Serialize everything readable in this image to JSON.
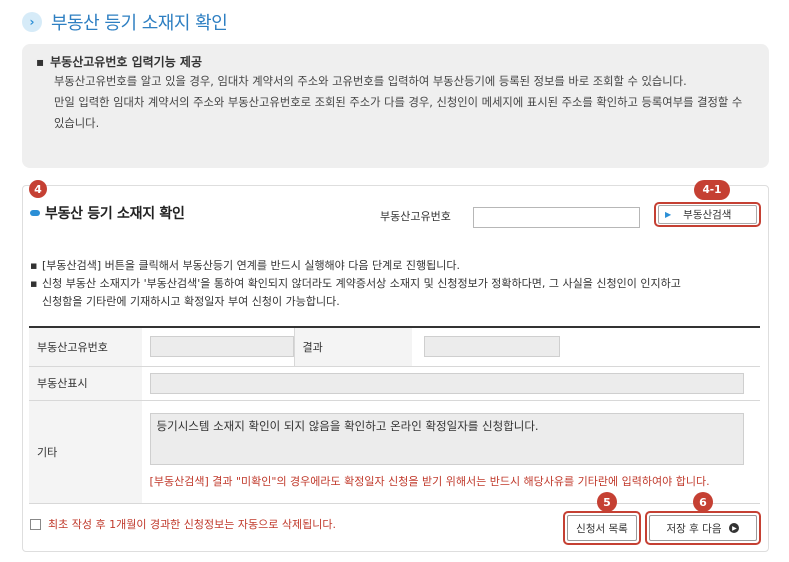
{
  "page_title": "부동산 등기 소재지 확인",
  "info": {
    "heading": "부동산고유번호 입력기능 제공",
    "bullet": "▪",
    "para1": "부동산고유번호를 알고 있을 경우, 임대차 계약서의 주소와 고유번호를 입력하여 부동산등기에 등록된 정보를 바로 조회할 수 있습니다.",
    "para2": "만일 입력한 임대차 계약서의 주소와 부동산고유번호로 조회된 주소가 다를 경우, 신청인이 메세지에 표시된 주소를 확인하고 등록여부를 결정할 수 있습니다."
  },
  "section": {
    "badge": "4",
    "title": "부동산 등기 소재지 확인",
    "uid_label": "부동산고유번호",
    "uid_value": "",
    "search_badge": "4-1",
    "search_button": "부동산검색"
  },
  "notes": {
    "bullet": "▪",
    "note1": "[부동산검색] 버튼을 클릭해서 부동산등기 연계를 반드시 실행해야 다음 단계로 진행됩니다.",
    "note2_line1": "신청 부동산 소재지가 '부동산검색'을 통하여 확인되지 않더라도 계약증서상 소재지 및 신청정보가 정확하다면, 그 사실을 신청인이 인지하고",
    "note2_line2": "신청함을 기타란에 기재하시고 확정일자 부여 신청이 가능합니다."
  },
  "table": {
    "uid_label": "부동산고유번호",
    "uid_value": "",
    "result_label": "결과",
    "result_value": "",
    "display_label": "부동산표시",
    "display_value": "",
    "etc_label": "기타",
    "etc_value": "등기시스템 소재지 확인이 되지 않음을 확인하고 온라인 확정일자를 신청합니다.",
    "etc_note": "[부동산검색] 결과 \"미확인\"의 경우에라도 확정일자 신청을 받기 위해서는 반드시 해당사유를 기타란에 입력하여야 합니다."
  },
  "footer": {
    "auto_delete_notice": "최초 작성 후 1개월이 경과한 신청정보는 자동으로 삭제됩니다.",
    "list_badge": "5",
    "list_button": "신청서 목록",
    "next_badge": "6",
    "next_button": "저장 후 다음"
  },
  "colors": {
    "accent": "#2e7fc2",
    "marker": "#c54033",
    "warning": "#c0392b"
  },
  "icons": {
    "title": "chevron-right-icon",
    "search": "arrow-right-icon",
    "next": "circle-arrow-icon"
  }
}
